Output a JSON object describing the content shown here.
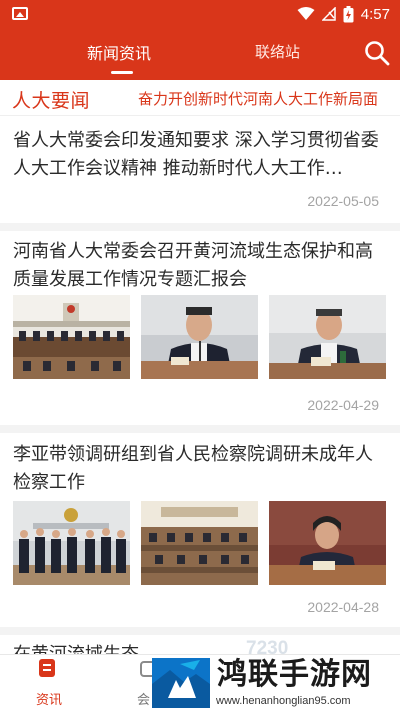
{
  "status_bar": {
    "time": "4:57",
    "battery_level": 0.8
  },
  "header": {
    "tabs": [
      {
        "label": "新闻资讯",
        "active": true
      },
      {
        "label": "联络站",
        "active": false
      }
    ],
    "search_icon": "search-icon"
  },
  "ticker": {
    "label": "人大要闻",
    "text": "奋力开创新时代河南人大工作新局面"
  },
  "articles": [
    {
      "title": "省人大常委会印发通知要求 深入学习贯彻省委人大工作会议精神 推动新时代人大工作…",
      "date": "2022-05-05"
    },
    {
      "title": "河南省人大常委会召开黄河流域生态保护和高质量发展工作情况专题汇报会",
      "date": "2022-04-29"
    },
    {
      "title": "李亚带领调研组到省人民检察院调研未成年人检察工作",
      "date": "2022-04-28"
    },
    {
      "title": "在黄河流域生态"
    }
  ],
  "bottom_nav": [
    {
      "label": "资讯",
      "icon": "news-icon",
      "active": true
    },
    {
      "label": "会",
      "icon": "meeting-icon",
      "active": false
    }
  ],
  "watermark": {
    "ghost": "7230",
    "name": "鸿联手游网",
    "url": "www.henanhonglian95.com"
  },
  "colors": {
    "brand": "#d9361a",
    "date": "#a4a4a4",
    "separator": "#f3f3f3"
  }
}
